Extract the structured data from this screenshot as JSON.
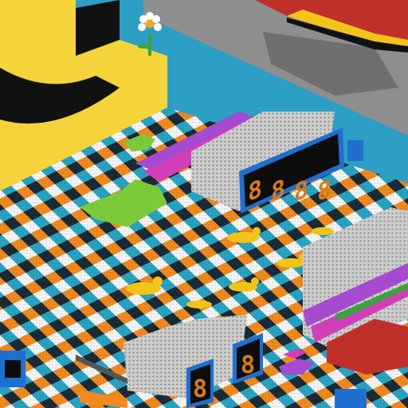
{
  "scene": {
    "kind": "isometric voxel game world",
    "displays": [
      {
        "id": "large-display",
        "digits": [
          "8",
          "8",
          "8",
          "8"
        ]
      },
      {
        "id": "small-display-left",
        "digits": [
          "8"
        ]
      },
      {
        "id": "small-display-right",
        "digits": [
          "8"
        ]
      }
    ],
    "floor": {
      "pattern": "checkerboard",
      "colors": [
        "#f08a1f",
        "#1a2a36",
        "#f4f4f4",
        "#28a3c2"
      ]
    },
    "ducks": {
      "count": 6,
      "color": "#f2c418"
    },
    "flower": {
      "petal": "#ffffff",
      "center": "#f2a81f",
      "stem": "#3aa33a"
    }
  },
  "colors": {
    "wall_blue": "#2d9ec4",
    "wall_yellow": "#f5d33a",
    "stripe_black": "#111111",
    "display_frame": "#1f6fd0",
    "display_bg": "#0d0d0d",
    "digit": "#d97a1a",
    "green_blob": "#7cc93a",
    "road_grey": "#8e8e8e",
    "red_brick": "#c0302a",
    "purple_rail": "#a54bd1",
    "magenta_rail": "#d13fb8"
  }
}
